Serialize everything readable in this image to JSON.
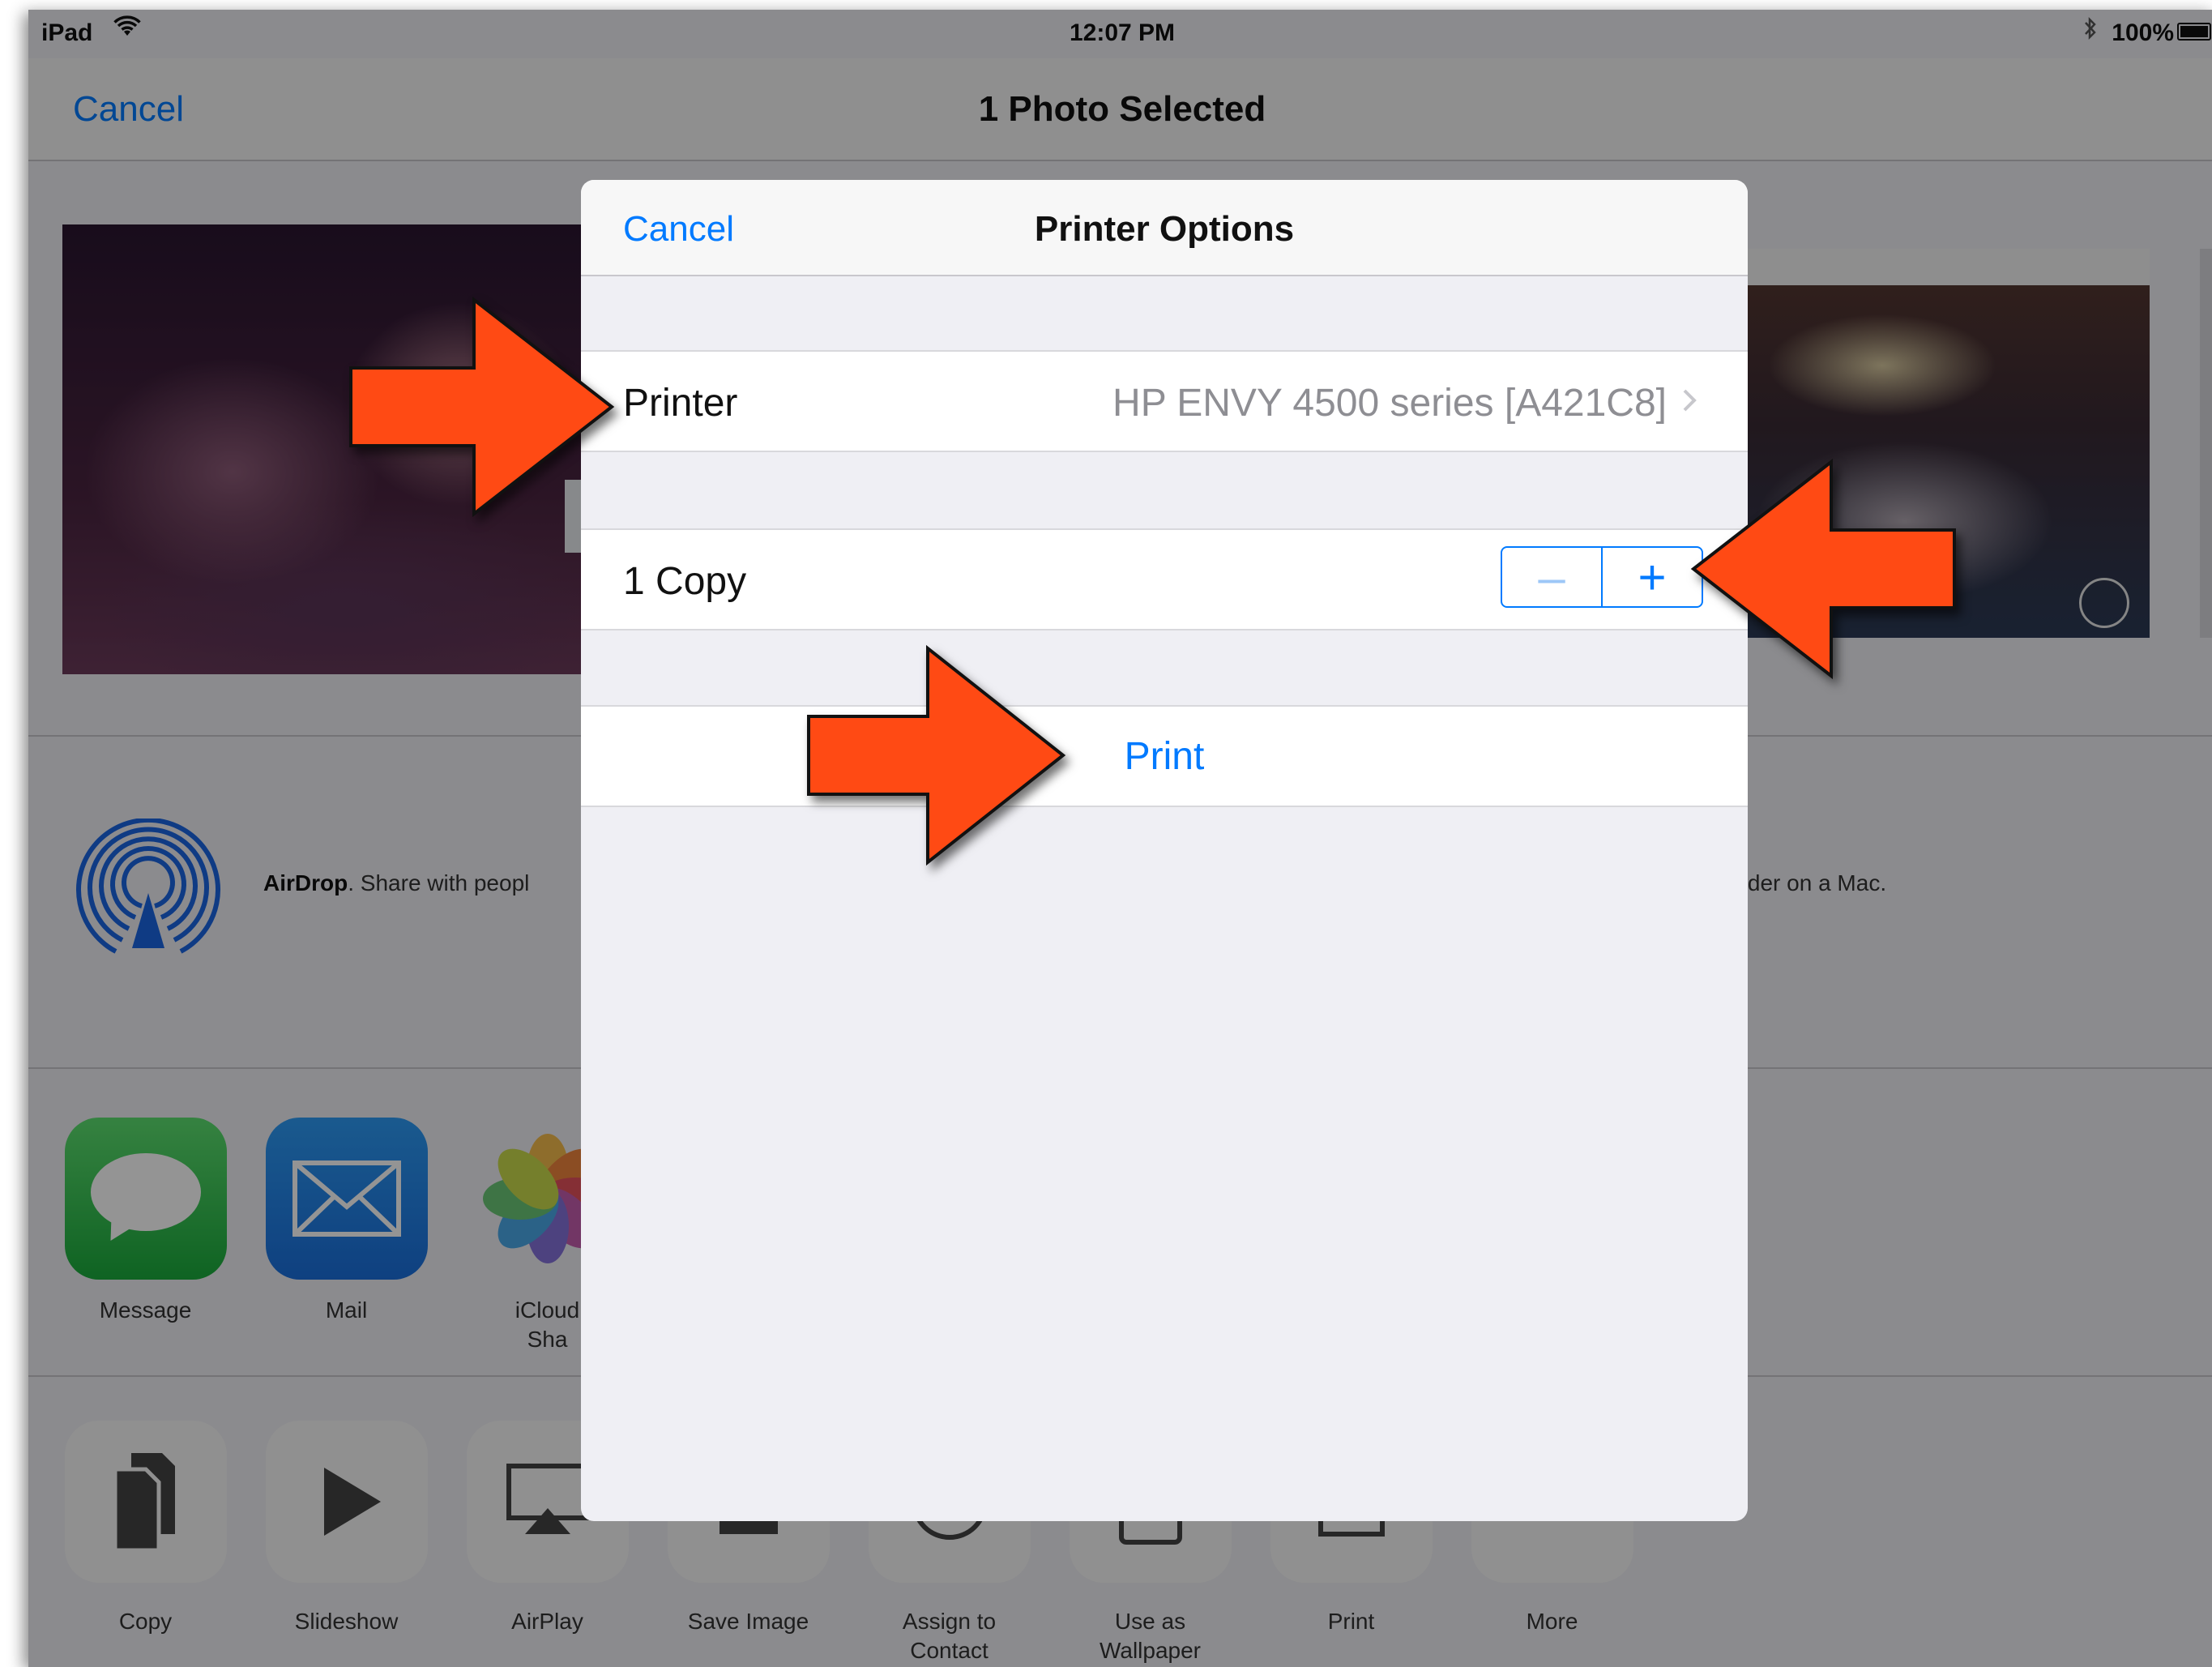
{
  "status_bar": {
    "carrier": "iPad",
    "wifi_icon": "wifi-icon",
    "time": "12:07 PM",
    "bluetooth_icon": "bluetooth-icon",
    "battery_pct": "100%"
  },
  "nav": {
    "cancel_label": "Cancel",
    "title": "1 Photo Selected"
  },
  "airdrop": {
    "name": "AirDrop",
    "text_left": ". Share with peopl",
    "text_right": "Finder on a Mac."
  },
  "share_apps": [
    {
      "label": "Message",
      "icon": "message-icon"
    },
    {
      "label": "Mail",
      "icon": "mail-icon"
    },
    {
      "label": "iCloud",
      "label2": "Sha",
      "icon": "photos-icon"
    }
  ],
  "actions": [
    {
      "label": "Copy",
      "icon": "copy-icon"
    },
    {
      "label": "Slideshow",
      "icon": "play-icon"
    },
    {
      "label": "AirPlay",
      "icon": "airplay-icon"
    },
    {
      "label": "Save Image",
      "icon": "save-image-icon"
    },
    {
      "label": "Assign to",
      "label2": "Contact",
      "icon": "contact-icon"
    },
    {
      "label": "Use as Wallpaper",
      "icon": "wallpaper-icon"
    },
    {
      "label": "Print",
      "icon": "print-icon"
    },
    {
      "label": "More",
      "icon": "more-icon"
    }
  ],
  "printer_options": {
    "cancel_label": "Cancel",
    "title": "Printer Options",
    "printer_label": "Printer",
    "printer_value": "HP ENVY 4500 series [A421C8]",
    "copies_label": "1 Copy",
    "copies": 1,
    "minus_symbol": "–",
    "plus_symbol": "+",
    "print_label": "Print"
  },
  "colors": {
    "accent": "#007aff",
    "annotation_arrow": "#ff4a14"
  }
}
